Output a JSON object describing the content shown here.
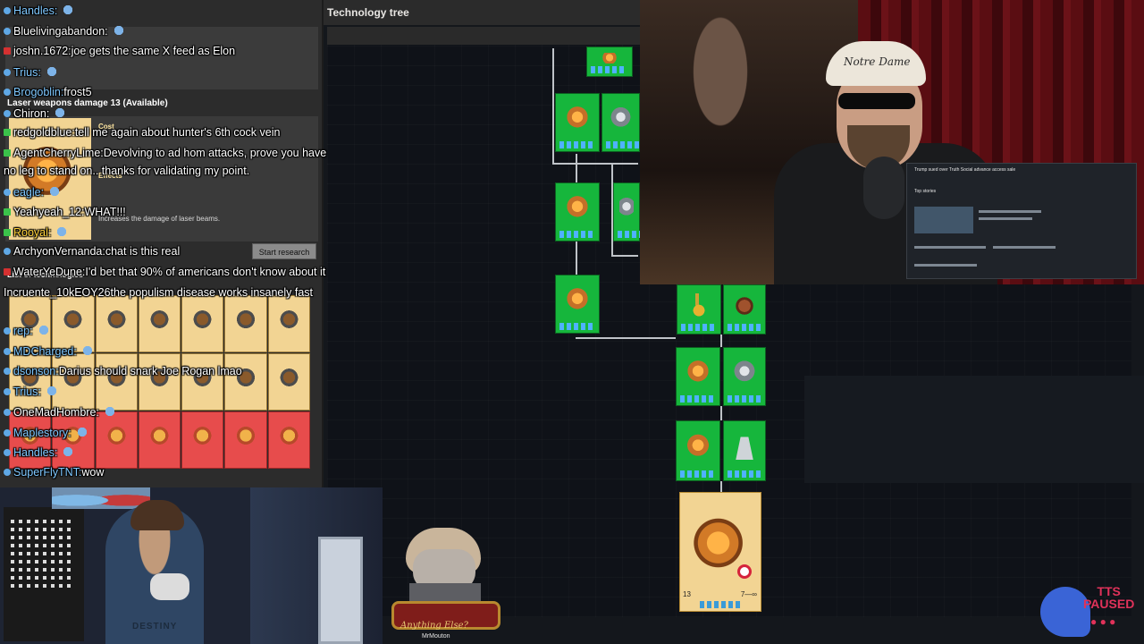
{
  "game": {
    "tech_tree_title": "Technology tree",
    "research": {
      "title": "Laser weapons damage 13 (Available)",
      "cost_label": "Cost",
      "effects_label": "Effects",
      "effect_description": "Increases the damage of laser beams.",
      "start_button": "Start research",
      "list_label": "List of technologies"
    },
    "selected_card": {
      "level": "13",
      "time": "7—∞"
    }
  },
  "chat": {
    "messages": [
      {
        "user": "Handles:",
        "text": "",
        "pip": "blue",
        "user_color": "#7fc8ff"
      },
      {
        "user": "Bluelivingabandon:",
        "text": "",
        "pip": "blue",
        "user_color": "#ffffff"
      },
      {
        "user": "joshn.1672:",
        "text": "joe gets the same X feed as Elon",
        "pip": "red",
        "user_color": "#ffffff"
      },
      {
        "user": "Trius:",
        "text": "",
        "pip": "blue",
        "user_color": "#7fc8ff"
      },
      {
        "user": "Brogoblin:",
        "text": "frost5",
        "pip": "blue",
        "user_color": "#7fc8ff"
      },
      {
        "user": "Chiron:",
        "text": "",
        "pip": "blue",
        "user_color": "#ffffff"
      },
      {
        "user": "redgoldblue:",
        "text": "tell me again about hunter's 6th cock vein",
        "pip": "green",
        "user_color": "#ffffff"
      },
      {
        "user": "AgentCherryLime:",
        "text": "Devolving to ad hom attacks, prove you have",
        "pip": "green",
        "user_color": "#ffffff"
      },
      {
        "user": "",
        "text": "no leg to stand on.. thanks for validating my point.",
        "pip": "",
        "user_color": "#ffffff"
      },
      {
        "user": "eagle:",
        "text": "",
        "pip": "blue",
        "user_color": "#7fc8ff"
      },
      {
        "user": "Yeahyeah_12:",
        "text": "WHAT!!!",
        "pip": "green",
        "user_color": "#ffffff"
      },
      {
        "user": "Rooyal:",
        "text": "",
        "pip": "green",
        "user_color": "#ffd23b"
      },
      {
        "user": "ArchyonVernanda:",
        "text": "chat is this real",
        "pip": "blue",
        "user_color": "#ffffff"
      },
      {
        "user": "WaterYeDune:",
        "text": "I'd bet that 90% of americans don't know about it",
        "pip": "red",
        "user_color": "#ffffff"
      },
      {
        "user": "Incruente_10kEOY26",
        "text": "the populism disease works insanely fast",
        "pip": "",
        "user_color": "#ffffff"
      },
      {
        "user": "rep:",
        "text": "",
        "pip": "blue",
        "user_color": "#7fc8ff"
      },
      {
        "user": "MDCharged:",
        "text": "",
        "pip": "blue",
        "user_color": "#7fc8ff"
      },
      {
        "user": "dsonson:",
        "text": "Darius should snark Joe Rogan lmao",
        "pip": "blue",
        "user_color": "#7fc8ff"
      },
      {
        "user": "Trius:",
        "text": "",
        "pip": "blue",
        "user_color": "#7fc8ff"
      },
      {
        "user": "OneMadHombre:",
        "text": "",
        "pip": "blue",
        "user_color": "#ffffff"
      },
      {
        "user": "Maplestory:",
        "text": "",
        "pip": "blue",
        "user_color": "#7fc8ff"
      },
      {
        "user": "Handles:",
        "text": "",
        "pip": "blue",
        "user_color": "#7fc8ff"
      },
      {
        "user": "SuperFlyTNT:",
        "text": "wow",
        "pip": "blue",
        "user_color": "#7fc8ff"
      }
    ]
  },
  "podcast": {
    "cap_text": "Notre Dame",
    "screen_title": "Trump sued over Truth Social advance access sale",
    "screen_sub": "Top stories"
  },
  "webcam": {
    "shirt_text": "DESTINY"
  },
  "avatar": {
    "desk_text": "Anything Else?",
    "name": "MrMouton"
  },
  "tts": {
    "line1": "TTS",
    "line2": "PAUSED",
    "dots": "● ● ●"
  },
  "colors": {
    "tech_green": "#16b63c",
    "research_tan": "#f2d493",
    "tts_red": "#e0325a",
    "chat_blue": "#7fc8ff"
  }
}
